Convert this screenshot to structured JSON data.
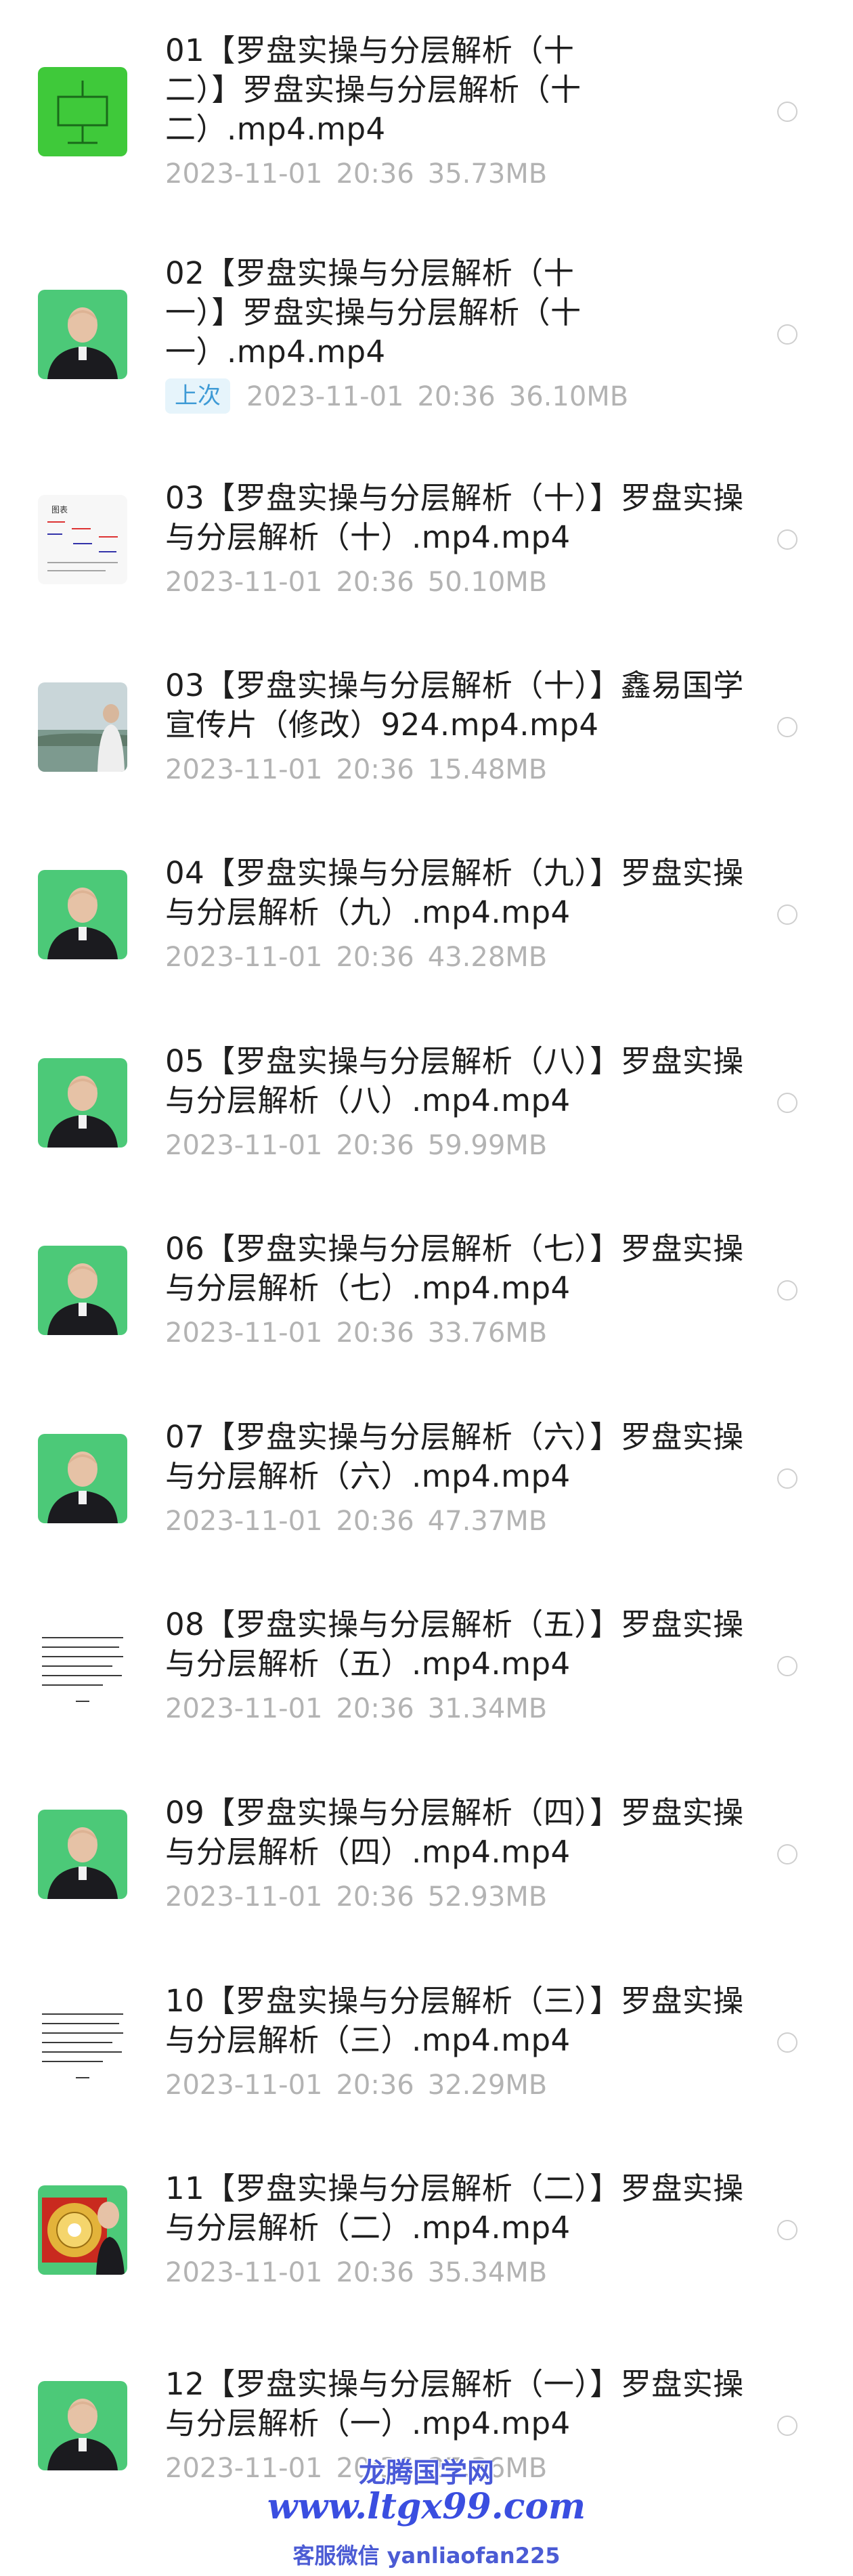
{
  "files": [
    {
      "title": "01【罗盘实操与分层解析（十\n二）】罗盘实操与分层解析（十\n二）.mp4.mp4",
      "date": "2023-11-01",
      "time": "20:36",
      "size": "35.73MB",
      "tag": "",
      "thumb": "green-diagram"
    },
    {
      "title": "02【罗盘实操与分层解析（十\n一）】罗盘实操与分层解析（十\n一）.mp4.mp4",
      "date": "2023-11-01",
      "time": "20:36",
      "size": "36.10MB",
      "tag": "上次",
      "thumb": "presenter"
    },
    {
      "title": "03【罗盘实操与分层解析（十）】罗盘实操与分层解析（十）.mp4.mp4",
      "date": "2023-11-01",
      "time": "20:36",
      "size": "50.10MB",
      "tag": "",
      "thumb": "chart-sheet"
    },
    {
      "title": "03【罗盘实操与分层解析（十）】鑫易国学宣传片（修改）924.mp4.mp4",
      "date": "2023-11-01",
      "time": "20:36",
      "size": "15.48MB",
      "tag": "",
      "thumb": "outdoor"
    },
    {
      "title": "04【罗盘实操与分层解析（九）】罗盘实操与分层解析（九）.mp4.mp4",
      "date": "2023-11-01",
      "time": "20:36",
      "size": "43.28MB",
      "tag": "",
      "thumb": "presenter"
    },
    {
      "title": "05【罗盘实操与分层解析（八）】罗盘实操与分层解析（八）.mp4.mp4",
      "date": "2023-11-01",
      "time": "20:36",
      "size": "59.99MB",
      "tag": "",
      "thumb": "presenter"
    },
    {
      "title": "06【罗盘实操与分层解析（七）】罗盘实操与分层解析（七）.mp4.mp4",
      "date": "2023-11-01",
      "time": "20:36",
      "size": "33.76MB",
      "tag": "",
      "thumb": "presenter"
    },
    {
      "title": "07【罗盘实操与分层解析（六）】罗盘实操与分层解析（六）.mp4.mp4",
      "date": "2023-11-01",
      "time": "20:36",
      "size": "47.37MB",
      "tag": "",
      "thumb": "presenter"
    },
    {
      "title": "08【罗盘实操与分层解析（五）】罗盘实操与分层解析（五）.mp4.mp4",
      "date": "2023-11-01",
      "time": "20:36",
      "size": "31.34MB",
      "tag": "",
      "thumb": "text-doc"
    },
    {
      "title": "09【罗盘实操与分层解析（四）】罗盘实操与分层解析（四）.mp4.mp4",
      "date": "2023-11-01",
      "time": "20:36",
      "size": "52.93MB",
      "tag": "",
      "thumb": "presenter"
    },
    {
      "title": "10【罗盘实操与分层解析（三）】罗盘实操与分层解析（三）.mp4.mp4",
      "date": "2023-11-01",
      "time": "20:36",
      "size": "32.29MB",
      "tag": "",
      "thumb": "text-doc"
    },
    {
      "title": "11【罗盘实操与分层解析（二）】罗盘实操与分层解析（二）.mp4.mp4",
      "date": "2023-11-01",
      "time": "20:36",
      "size": "35.34MB",
      "tag": "",
      "thumb": "compass"
    },
    {
      "title": "12【罗盘实操与分层解析（一）】罗盘实操与分层解析（一）.mp4.mp4",
      "date": "2023-11-01",
      "time": "20:36",
      "size": "27.36MB",
      "tag": "",
      "thumb": "presenter"
    }
  ],
  "watermark": {
    "site_name": "龙腾国学网",
    "url": "www.ltgx99.com",
    "contact": "客服微信 yanliaofan225"
  },
  "colors": {
    "title": "#1e1e1e",
    "meta": "#b3b3b3",
    "tag_bg": "#e6f4fb",
    "tag_text": "#3f9bd6",
    "radio_border": "#cfcfcf",
    "watermark": "#3a4ee0"
  }
}
